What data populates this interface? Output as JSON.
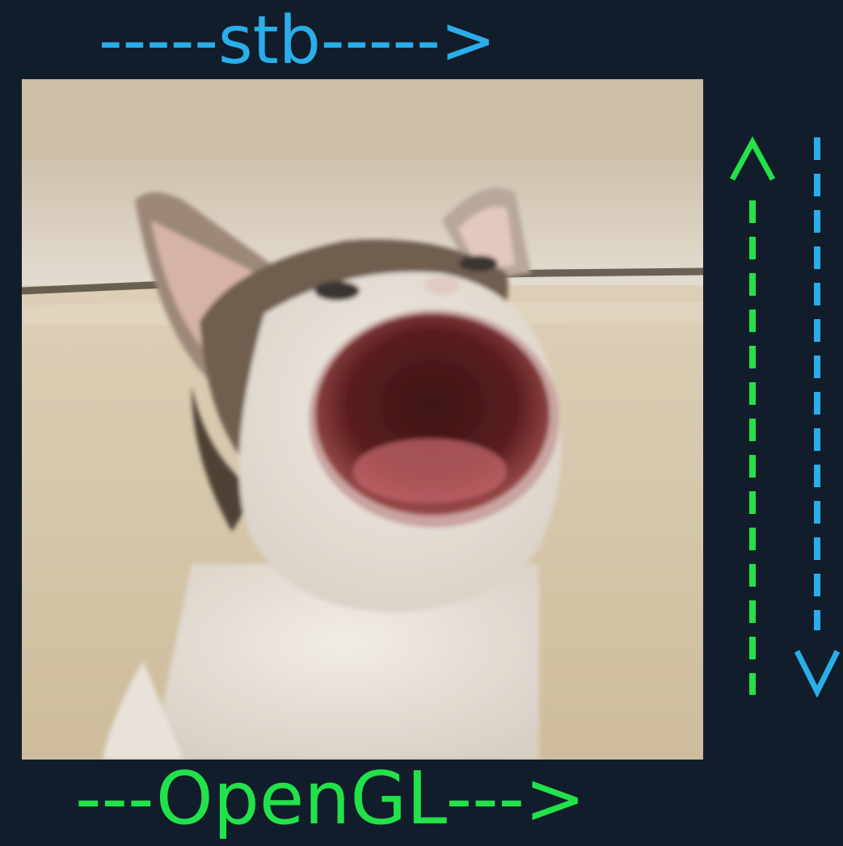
{
  "top_label": {
    "text": "-----stb----->",
    "color": "#2aaeea"
  },
  "bottom_label": {
    "text": "---OpenGL--->",
    "color": "#22e24a"
  },
  "image": {
    "subject": "cat-photo",
    "description_icon": "cat-open-mouth-photo"
  },
  "axes": {
    "opengl_y": {
      "direction": "up",
      "color": "#22e24a",
      "glyph": "^"
    },
    "stb_y": {
      "direction": "down",
      "color": "#2aaeea",
      "glyph": "V"
    }
  }
}
